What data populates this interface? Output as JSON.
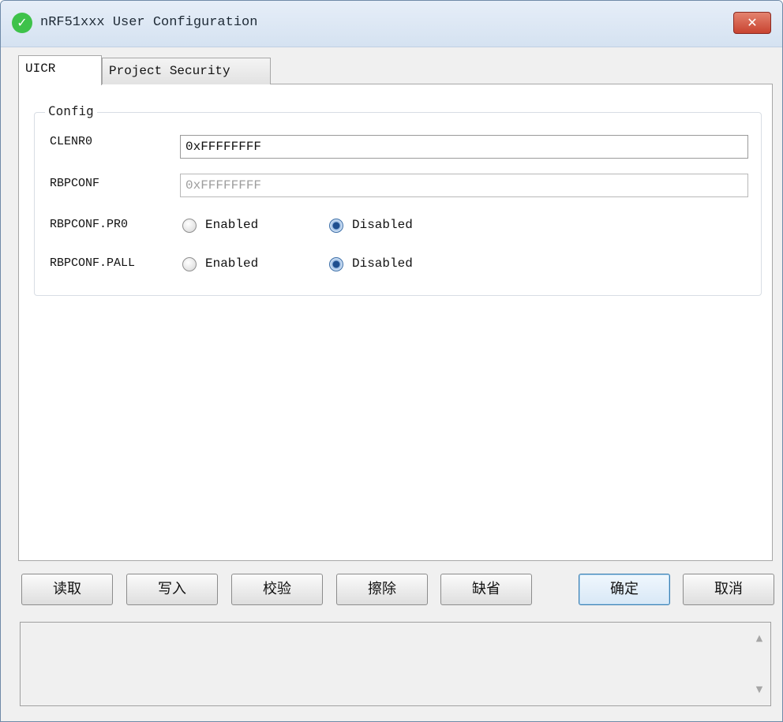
{
  "window": {
    "title": "nRF51xxx User Configuration",
    "close_label": "✕",
    "title_icon_glyph": "✓"
  },
  "tabs": [
    {
      "label": "UICR",
      "active": true
    },
    {
      "label": "Project Security",
      "active": false
    }
  ],
  "config": {
    "group_title": "Config",
    "clenr0": {
      "label": "CLENR0",
      "value": "0xFFFFFFFF"
    },
    "rbpconf": {
      "label": "RBPCONF",
      "value": "0xFFFFFFFF",
      "disabled": true
    },
    "rbpconf_pr0": {
      "label": "RBPCONF.PR0",
      "enabled_label": "Enabled",
      "disabled_label": "Disabled",
      "selected": "Disabled"
    },
    "rbpconf_pall": {
      "label": "RBPCONF.PALL",
      "enabled_label": "Enabled",
      "disabled_label": "Disabled",
      "selected": "Disabled"
    }
  },
  "buttons": {
    "read": "读取",
    "write": "写入",
    "verify": "校验",
    "erase": "擦除",
    "default": "缺省",
    "ok": "确定",
    "cancel": "取消"
  },
  "log": {
    "text": ""
  },
  "scroll": {
    "up": "▲",
    "down": "▼"
  },
  "colors": {
    "accent": "#3c7fb1",
    "close": "#c84330",
    "success_icon": "#3ec24a"
  }
}
